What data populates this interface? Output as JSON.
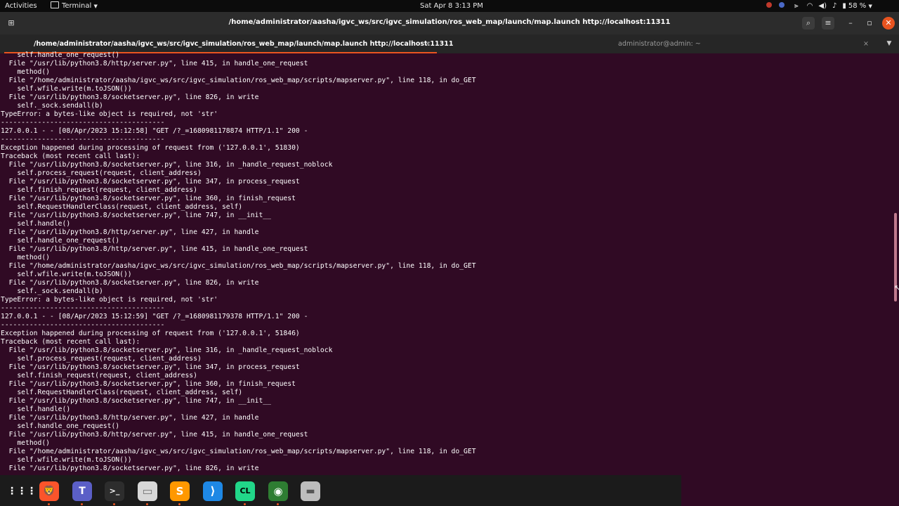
{
  "topbar": {
    "activities": "Activities",
    "app_name": "Terminal",
    "clock": "Sat Apr 8  3:13 PM",
    "battery": "58 %"
  },
  "window": {
    "title": "/home/administrator/aasha/igvc_ws/src/igvc_simulation/ros_web_map/launch/map.launch http://localhost:11311"
  },
  "tabs": [
    {
      "label": "/home/administrator/aasha/igvc_ws/src/igvc_simulation/ros_web_map/launch/map.launch http://localhost:11311",
      "close": "×"
    },
    {
      "label": "administrator@admin: ~",
      "close": "×"
    }
  ],
  "terminal": {
    "lines": [
      "    self.handle_one_request()",
      "  File \"/usr/lib/python3.8/http/server.py\", line 415, in handle_one_request",
      "    method()",
      "  File \"/home/administrator/aasha/igvc_ws/src/igvc_simulation/ros_web_map/scripts/mapserver.py\", line 118, in do_GET",
      "    self.wfile.write(m.toJSON())",
      "  File \"/usr/lib/python3.8/socketserver.py\", line 826, in write",
      "    self._sock.sendall(b)",
      "TypeError: a bytes-like object is required, not 'str'",
      "----------------------------------------",
      "127.0.0.1 - - [08/Apr/2023 15:12:58] \"GET /?_=1680981178874 HTTP/1.1\" 200 -",
      "----------------------------------------",
      "Exception happened during processing of request from ('127.0.0.1', 51830)",
      "Traceback (most recent call last):",
      "  File \"/usr/lib/python3.8/socketserver.py\", line 316, in _handle_request_noblock",
      "    self.process_request(request, client_address)",
      "  File \"/usr/lib/python3.8/socketserver.py\", line 347, in process_request",
      "    self.finish_request(request, client_address)",
      "  File \"/usr/lib/python3.8/socketserver.py\", line 360, in finish_request",
      "    self.RequestHandlerClass(request, client_address, self)",
      "  File \"/usr/lib/python3.8/socketserver.py\", line 747, in __init__",
      "    self.handle()",
      "  File \"/usr/lib/python3.8/http/server.py\", line 427, in handle",
      "    self.handle_one_request()",
      "  File \"/usr/lib/python3.8/http/server.py\", line 415, in handle_one_request",
      "    method()",
      "  File \"/home/administrator/aasha/igvc_ws/src/igvc_simulation/ros_web_map/scripts/mapserver.py\", line 118, in do_GET",
      "    self.wfile.write(m.toJSON())",
      "  File \"/usr/lib/python3.8/socketserver.py\", line 826, in write",
      "    self._sock.sendall(b)",
      "TypeError: a bytes-like object is required, not 'str'",
      "----------------------------------------",
      "127.0.0.1 - - [08/Apr/2023 15:12:59] \"GET /?_=1680981179378 HTTP/1.1\" 200 -",
      "----------------------------------------",
      "Exception happened during processing of request from ('127.0.0.1', 51846)",
      "Traceback (most recent call last):",
      "  File \"/usr/lib/python3.8/socketserver.py\", line 316, in _handle_request_noblock",
      "    self.process_request(request, client_address)",
      "  File \"/usr/lib/python3.8/socketserver.py\", line 347, in process_request",
      "    self.finish_request(request, client_address)",
      "  File \"/usr/lib/python3.8/socketserver.py\", line 360, in finish_request",
      "    self.RequestHandlerClass(request, client_address, self)",
      "  File \"/usr/lib/python3.8/socketserver.py\", line 747, in __init__",
      "    self.handle()",
      "  File \"/usr/lib/python3.8/http/server.py\", line 427, in handle",
      "    self.handle_one_request()",
      "  File \"/usr/lib/python3.8/http/server.py\", line 415, in handle_one_request",
      "    method()",
      "  File \"/home/administrator/aasha/igvc_ws/src/igvc_simulation/ros_web_map/scripts/mapserver.py\", line 118, in do_GET",
      "    self.wfile.write(m.toJSON())",
      "  File \"/usr/lib/python3.8/socketserver.py\", line 826, in write"
    ]
  },
  "dock": {
    "apps": [
      {
        "name": "app-grid",
        "glyph": "⋮⋮⋮",
        "running": false
      },
      {
        "name": "brave",
        "glyph": "🦁",
        "running": true
      },
      {
        "name": "teams",
        "glyph": "T",
        "running": true
      },
      {
        "name": "terminal",
        "glyph": ">_",
        "running": true
      },
      {
        "name": "files",
        "glyph": "▭",
        "running": true
      },
      {
        "name": "sublime-text",
        "glyph": "S",
        "running": true
      },
      {
        "name": "vscode",
        "glyph": "⟩",
        "running": false
      },
      {
        "name": "clion",
        "glyph": "CL",
        "running": true
      },
      {
        "name": "chrome",
        "glyph": "◉",
        "running": true
      },
      {
        "name": "disk",
        "glyph": "▬",
        "running": false
      }
    ]
  },
  "colors": {
    "terminal_bg": "#300a24",
    "accent": "#e95420"
  }
}
